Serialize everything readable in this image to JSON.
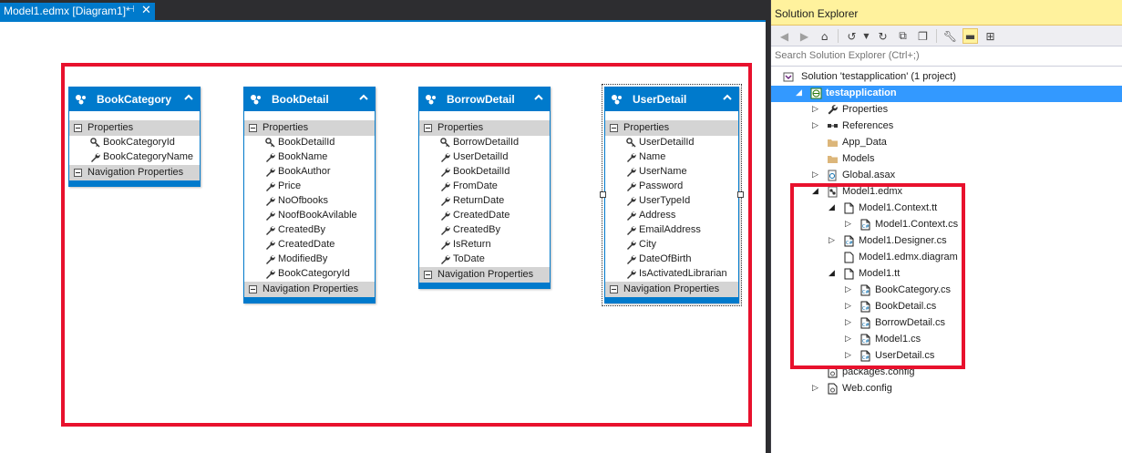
{
  "document": {
    "tab_title": "Model1.edmx [Diagram1]*",
    "pin_glyph": "⊣",
    "close_glyph": "✕"
  },
  "entities": [
    {
      "name": "BookCategory",
      "properties_label": "Properties",
      "navigation_label": "Navigation Properties",
      "properties": [
        {
          "name": "BookCategoryId",
          "key": true
        },
        {
          "name": "BookCategoryName",
          "key": false
        }
      ]
    },
    {
      "name": "BookDetail",
      "properties_label": "Properties",
      "navigation_label": "Navigation Properties",
      "properties": [
        {
          "name": "BookDetailId",
          "key": true
        },
        {
          "name": "BookName",
          "key": false
        },
        {
          "name": "BookAuthor",
          "key": false
        },
        {
          "name": "Price",
          "key": false
        },
        {
          "name": "NoOfbooks",
          "key": false
        },
        {
          "name": "NoofBookAvilable",
          "key": false
        },
        {
          "name": "CreatedBy",
          "key": false
        },
        {
          "name": "CreatedDate",
          "key": false
        },
        {
          "name": "ModifiedBy",
          "key": false
        },
        {
          "name": "BookCategoryId",
          "key": false
        }
      ]
    },
    {
      "name": "BorrowDetail",
      "properties_label": "Properties",
      "navigation_label": "Navigation Properties",
      "properties": [
        {
          "name": "BorrowDetailId",
          "key": true
        },
        {
          "name": "UserDetailId",
          "key": false
        },
        {
          "name": "BookDetailId",
          "key": false
        },
        {
          "name": "FromDate",
          "key": false
        },
        {
          "name": "ReturnDate",
          "key": false
        },
        {
          "name": "CreatedDate",
          "key": false
        },
        {
          "name": "CreatedBy",
          "key": false
        },
        {
          "name": "IsReturn",
          "key": false
        },
        {
          "name": "ToDate",
          "key": false
        }
      ]
    },
    {
      "name": "UserDetail",
      "properties_label": "Properties",
      "navigation_label": "Navigation Properties",
      "properties": [
        {
          "name": "UserDetailId",
          "key": true
        },
        {
          "name": "Name",
          "key": false
        },
        {
          "name": "UserName",
          "key": false
        },
        {
          "name": "Password",
          "key": false
        },
        {
          "name": "UserTypeId",
          "key": false
        },
        {
          "name": "Address",
          "key": false
        },
        {
          "name": "EmailAddress",
          "key": false
        },
        {
          "name": "City",
          "key": false
        },
        {
          "name": "DateOfBirth",
          "key": false
        },
        {
          "name": "IsActivatedLibrarian",
          "key": false
        }
      ]
    }
  ],
  "solution_explorer": {
    "title": "Solution Explorer",
    "search_placeholder": "Search Solution Explorer (Ctrl+;)",
    "toolbar_icons": [
      "back-icon",
      "forward-icon",
      "home-icon",
      "history-icon",
      "dropdown-icon",
      "refresh-icon",
      "collapse-all-icon",
      "show-all-files-icon",
      "properties-icon",
      "preview-icon",
      "class-view-icon"
    ],
    "colors": {
      "selection": "#3399ff",
      "title_bg": "#fff29d",
      "highlight": "#e8112d",
      "accent": "#007acc"
    },
    "tree": [
      {
        "label": "Solution 'testapplication' (1 project)",
        "icon": "solution-icon",
        "arrow": "",
        "depth": 0
      },
      {
        "label": "testapplication",
        "icon": "web-project-icon",
        "arrow": "expanded",
        "depth": 0,
        "selected": true
      },
      {
        "label": "Properties",
        "icon": "wrench-icon",
        "arrow": "collapsed",
        "depth": 1
      },
      {
        "label": "References",
        "icon": "references-icon",
        "arrow": "collapsed",
        "depth": 1
      },
      {
        "label": "App_Data",
        "icon": "folder-icon",
        "arrow": "",
        "depth": 1
      },
      {
        "label": "Models",
        "icon": "folder-icon",
        "arrow": "",
        "depth": 1
      },
      {
        "label": "Global.asax",
        "icon": "asax-icon",
        "arrow": "collapsed",
        "depth": 1
      },
      {
        "label": "Model1.edmx",
        "icon": "edmx-icon",
        "arrow": "expanded",
        "depth": 1
      },
      {
        "label": "Model1.Context.tt",
        "icon": "tt-file-icon",
        "arrow": "expanded",
        "depth": 2
      },
      {
        "label": "Model1.Context.cs",
        "icon": "cs-file-icon",
        "arrow": "collapsed",
        "depth": 3
      },
      {
        "label": "Model1.Designer.cs",
        "icon": "cs-file-icon",
        "arrow": "collapsed",
        "depth": 2
      },
      {
        "label": "Model1.edmx.diagram",
        "icon": "diagram-file-icon",
        "arrow": "",
        "depth": 2
      },
      {
        "label": "Model1.tt",
        "icon": "tt-file-icon",
        "arrow": "expanded",
        "depth": 2
      },
      {
        "label": "BookCategory.cs",
        "icon": "cs-file-icon",
        "arrow": "collapsed",
        "depth": 3
      },
      {
        "label": "BookDetail.cs",
        "icon": "cs-file-icon",
        "arrow": "collapsed",
        "depth": 3
      },
      {
        "label": "BorrowDetail.cs",
        "icon": "cs-file-icon",
        "arrow": "collapsed",
        "depth": 3
      },
      {
        "label": "Model1.cs",
        "icon": "cs-file-icon",
        "arrow": "collapsed",
        "depth": 3
      },
      {
        "label": "UserDetail.cs",
        "icon": "cs-file-icon",
        "arrow": "collapsed",
        "depth": 3
      },
      {
        "label": "packages.config",
        "icon": "config-file-icon",
        "arrow": "",
        "depth": 1
      },
      {
        "label": "Web.config",
        "icon": "config-file-icon",
        "arrow": "collapsed",
        "depth": 1
      }
    ]
  }
}
